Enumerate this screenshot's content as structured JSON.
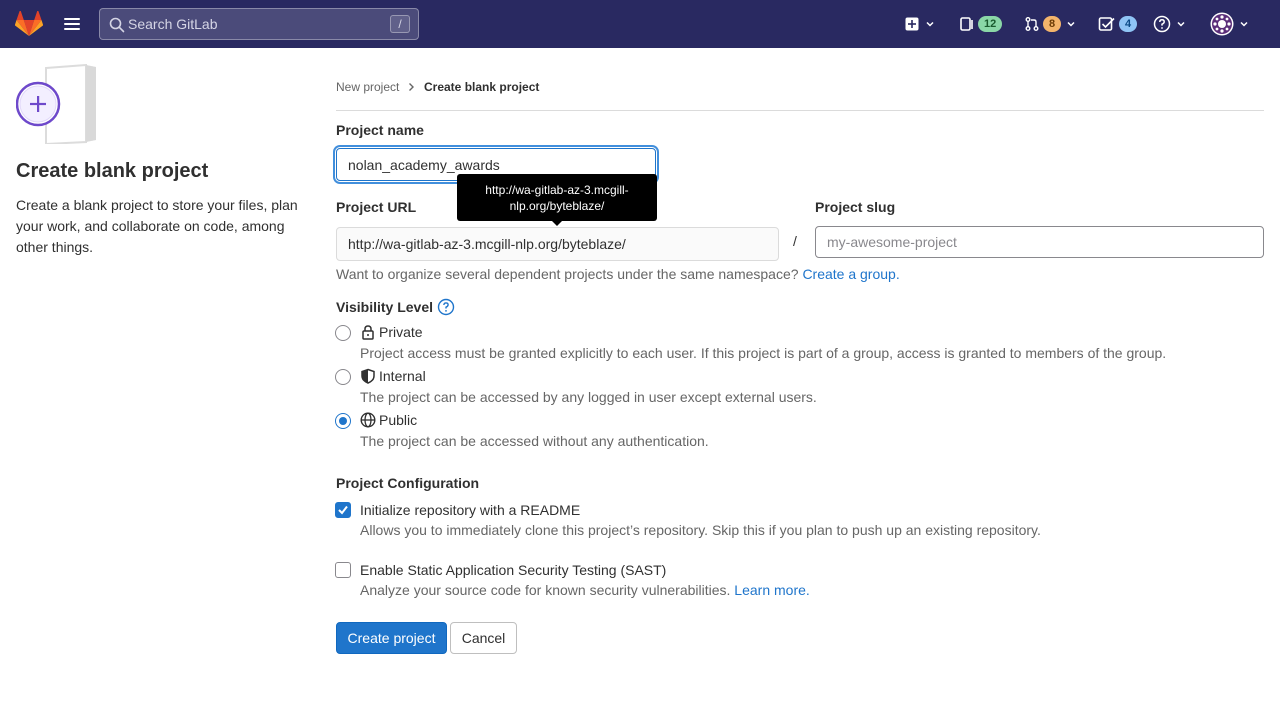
{
  "navbar": {
    "search_placeholder": "Search GitLab",
    "search_shortcut": "/",
    "issues_count": "12",
    "merge_requests_count": "8",
    "todos_count": "4"
  },
  "left": {
    "title": "Create blank project",
    "description": "Create a blank project to store your files, plan your work, and collaborate on code, among other things."
  },
  "breadcrumb": {
    "parent": "New project",
    "current": "Create blank project"
  },
  "form": {
    "project_name_label": "Project name",
    "project_name_value": "nolan_academy_awards",
    "project_url_label": "Project URL",
    "project_url_value": "http://wa-gitlab-az-3.mcgill-nlp.org/byteblaze/",
    "tooltip_text": "http://wa-gitlab-az-3.mcgill-nlp.org/byteblaze/",
    "slash": "/",
    "project_slug_label": "Project slug",
    "project_slug_placeholder": "my-awesome-project",
    "namespace_help": "Want to organize several dependent projects under the same namespace?",
    "create_group_link": "Create a group.",
    "visibility_label": "Visibility Level",
    "visibility_options": [
      {
        "label": "Private",
        "description": "Project access must be granted explicitly to each user. If this project is part of a group, access is granted to members of the group.",
        "checked": false
      },
      {
        "label": "Internal",
        "description": "The project can be accessed by any logged in user except external users.",
        "checked": false
      },
      {
        "label": "Public",
        "description": "The project can be accessed without any authentication.",
        "checked": true
      }
    ],
    "config_label": "Project Configuration",
    "readme_label": "Initialize repository with a README",
    "readme_desc": "Allows you to immediately clone this project’s repository. Skip this if you plan to push up an existing repository.",
    "readme_checked": true,
    "sast_label": "Enable Static Application Security Testing (SAST)",
    "sast_desc": "Analyze your source code for known security vulnerabilities.",
    "learn_more": "Learn more.",
    "sast_checked": false,
    "create_button": "Create project",
    "cancel_button": "Cancel"
  },
  "colors": {
    "navbar_bg": "#292961",
    "primary": "#1f75cb",
    "illustration_purple": "#6e49cb"
  }
}
